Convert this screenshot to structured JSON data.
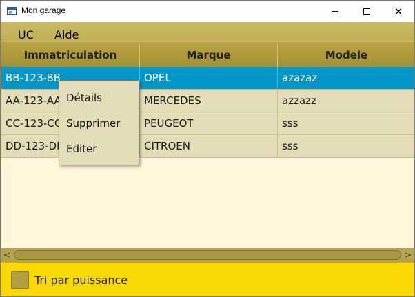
{
  "window": {
    "title": "Mon garage",
    "controls": {
      "minimize": "minimize-icon",
      "maximize": "maximize-icon",
      "close": "✕"
    }
  },
  "menu": {
    "items": [
      {
        "label": "UC"
      },
      {
        "label": "Aide"
      }
    ]
  },
  "table": {
    "columns": [
      "Immatriculation",
      "Marque",
      "Modele"
    ],
    "rows": [
      {
        "plate": "BB-123-BB",
        "brand": "OPEL",
        "model": "azazaz",
        "selected": true
      },
      {
        "plate": "AA-123-AA",
        "brand": "MERCEDES",
        "model": "azzazz",
        "selected": false
      },
      {
        "plate": "CC-123-CC",
        "brand": "PEUGEOT",
        "model": "sss",
        "selected": false
      },
      {
        "plate": "DD-123-DD",
        "brand": "CITROEN",
        "model": "sss",
        "selected": false
      }
    ],
    "scrollbar": {
      "left_arrow": "<",
      "right_arrow": ">"
    }
  },
  "context_menu": {
    "items": [
      "Détails",
      "Supprimer",
      "Editer"
    ]
  },
  "footer": {
    "checkbox_label": "Tri par puissance",
    "checkbox_checked": false
  },
  "colors": {
    "menubar": "#c4b45c",
    "header": "#ad9a3b",
    "selected_row": "#0096c9",
    "row": "#e2ddb8",
    "table_bg": "#fff6dc",
    "footer": "#f8d800"
  }
}
